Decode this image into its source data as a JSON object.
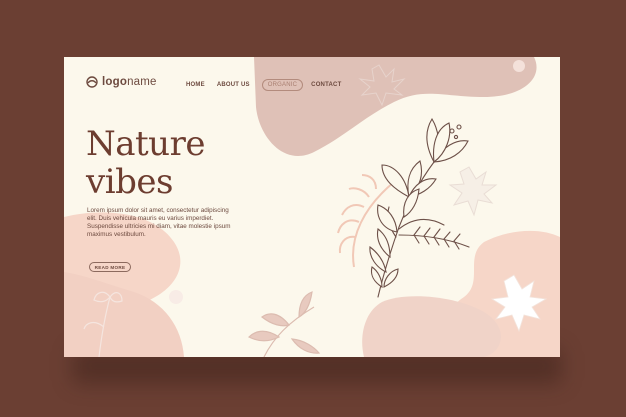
{
  "brand": {
    "logo_bold": "logo",
    "logo_light": "name"
  },
  "nav": {
    "home": "HOME",
    "about": "ABOUT US",
    "organic": "ORGANIC",
    "contact": "CONTACT"
  },
  "hero": {
    "headline": "Nature\nvibes",
    "body": "Lorem ipsum dolor sit amet, consectetur adipiscing elit. Duis vehicula mauris eu varius imperdiet. Suspendisse ultricies mi diam, vitae molestie ipsum maximus vestibulum.",
    "cta_label": "READ MORE"
  },
  "colors": {
    "page_background": "#6b3f33",
    "card_background": "#fcf8ec",
    "blob_pink": "#f6d6c8",
    "blob_mauve": "#dfc1b7",
    "text_brown": "#6d3d30"
  }
}
